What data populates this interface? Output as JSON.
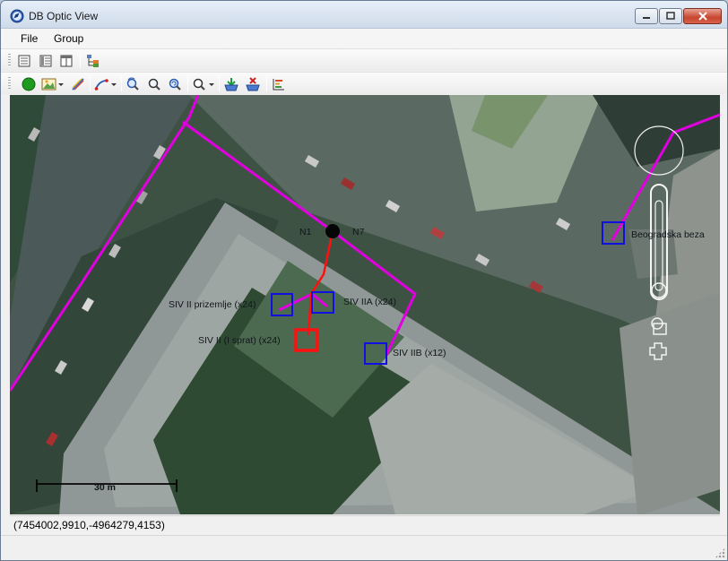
{
  "window": {
    "title": "DB Optic View"
  },
  "menu": {
    "items": [
      "File",
      "Group"
    ]
  },
  "map": {
    "labels": {
      "n1": "N1",
      "n7": "N7",
      "siv_prizemlje": "SIV II prizemlje (x24)",
      "siv_iia": "SIV IIA (x24)",
      "siv_isprat": "SIV II (I sprat) (x24)",
      "siv_iib": "SIV IIB (x12)",
      "beogradska": "Beogradska beza"
    },
    "scale_label": "30 m",
    "colors": {
      "route": "#e000e0",
      "active_link": "#ff1010",
      "node_box": "#1010e0",
      "selected_box": "#ff1010"
    }
  },
  "status": {
    "coordinates": "(7454002,9910,-4964279,4153)"
  }
}
